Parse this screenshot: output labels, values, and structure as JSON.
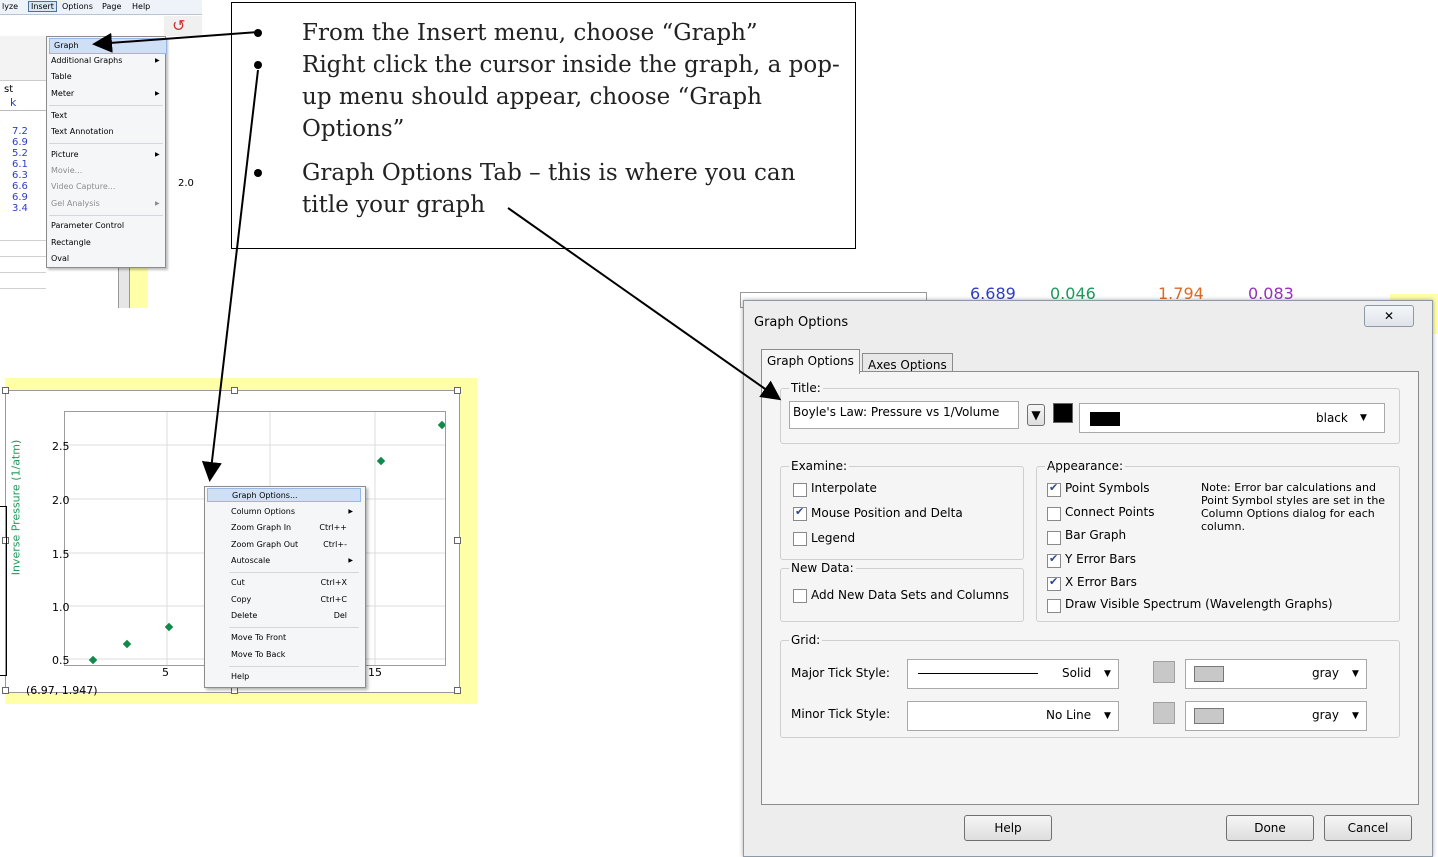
{
  "instructions": [
    "From the Insert menu, choose “Graph”",
    "Right click the cursor inside the graph, a pop-up menu should appear, choose “Graph Options”",
    "Graph Options Tab – this is where you can title your graph"
  ],
  "menubar": {
    "analyze": "lyze",
    "insert": "Insert",
    "options": "Options",
    "page": "Page",
    "help": "Help"
  },
  "insert_menu": {
    "graph": "Graph",
    "additional_graphs": "Additional Graphs",
    "table": "Table",
    "meter": "Meter",
    "text": "Text",
    "text_annotation": "Text Annotation",
    "picture": "Picture",
    "movie": "Movie...",
    "video_capture": "Video Capture...",
    "gel_analysis": "Gel Analysis",
    "parameter_control": "Parameter Control",
    "rectangle": "Rectangle",
    "oval": "Oval"
  },
  "left_table": {
    "header_a": "st",
    "header_b": "k",
    "values": [
      "7.2",
      "6.9",
      "5.2",
      "6.1",
      "6.3",
      "6.6",
      "6.9",
      "3.4"
    ],
    "axis_tick": "2.0"
  },
  "graph": {
    "y_label": "Inverse Pressure (1/atm)",
    "y_ticks": [
      "2.5",
      "2.0",
      "1.5",
      "1.0",
      "0.5"
    ],
    "x_ticks": [
      "5",
      "15"
    ],
    "coordinates": "(6.97, 1.947)"
  },
  "context_menu": {
    "graph_options": "Graph Options...",
    "column_options": "Column Options",
    "zoom_in": "Zoom Graph In",
    "zoom_in_key": "Ctrl++",
    "zoom_out": "Zoom Graph Out",
    "zoom_out_key": "Ctrl+-",
    "autoscale": "Autoscale",
    "cut": "Cut",
    "cut_key": "Ctrl+X",
    "copy": "Copy",
    "copy_key": "Ctrl+C",
    "delete": "Delete",
    "delete_key": "Del",
    "move_front": "Move To Front",
    "move_back": "Move To Back",
    "help": "Help"
  },
  "bg_table": {
    "v1": "6.689",
    "v2": "0.046",
    "v3": "1.794",
    "v4": "0.083"
  },
  "dialog": {
    "title": "Graph Options",
    "close": "✕",
    "tab_graph": "Graph Options",
    "tab_axes": "Axes Options",
    "title_group": "Title:",
    "title_value": "Boyle's Law: Pressure vs 1/Volume",
    "title_color": "black",
    "examine_group": "Examine:",
    "interpolate": "Interpolate",
    "mouse_pos": "Mouse Position and Delta",
    "legend": "Legend",
    "newdata_group": "New Data:",
    "add_new": "Add New Data Sets and Columns",
    "appearance_group": "Appearance:",
    "point_symbols": "Point Symbols",
    "connect_points": "Connect Points",
    "bar_graph": "Bar Graph",
    "y_error": "Y Error Bars",
    "x_error": "X Error Bars",
    "draw_spectrum": "Draw Visible Spectrum (Wavelength Graphs)",
    "note": "Note:  Error bar calculations and Point Symbol styles are set in the Column Options dialog for each column.",
    "grid_group": "Grid:",
    "major_label": "Major Tick Style:",
    "major_style": "Solid",
    "major_color": "gray",
    "minor_label": "Minor Tick Style:",
    "minor_style": "No Line",
    "minor_color": "gray",
    "help_btn": "Help",
    "done_btn": "Done",
    "cancel_btn": "Cancel"
  },
  "colors": {
    "point_green": "#0f8a4a",
    "menu_highlight": "#cfe0f6",
    "yellow_bg": "#ffffa8"
  }
}
